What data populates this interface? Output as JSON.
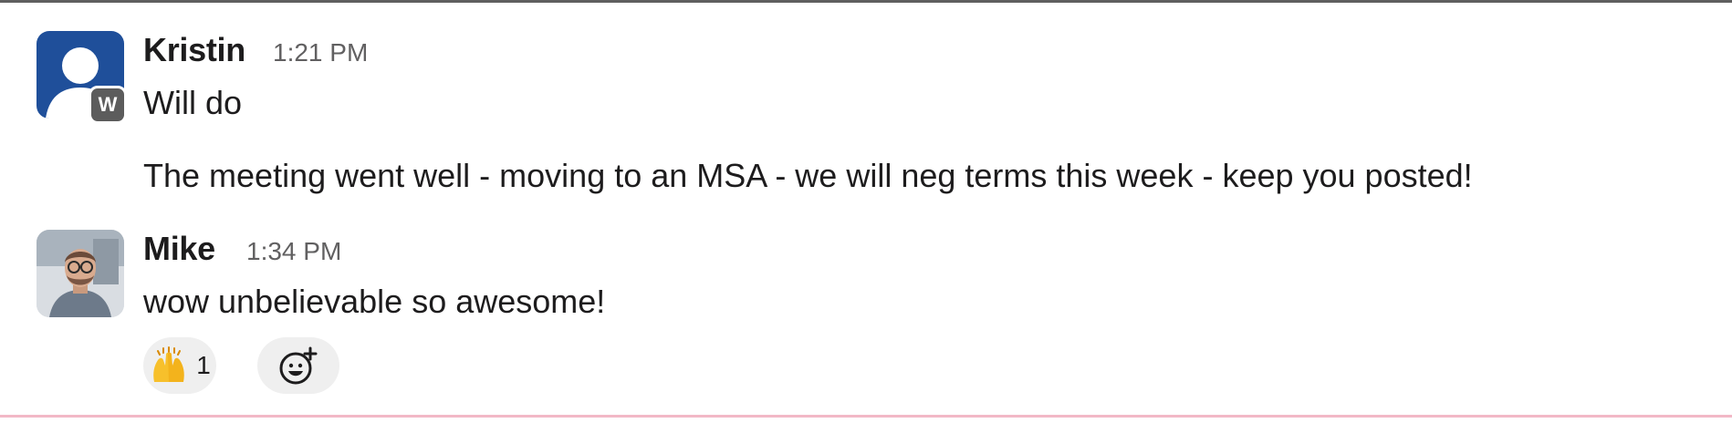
{
  "messages": [
    {
      "sender": "Kristin",
      "time": "1:21 PM",
      "workspace_badge": "W",
      "lines": [
        "Will do",
        "The meeting went well - moving to an MSA - we will neg terms this week - keep you posted!"
      ]
    },
    {
      "sender": "Mike",
      "time": "1:34 PM",
      "lines": [
        "wow unbelievable so awesome!"
      ],
      "reactions": [
        {
          "emoji": "raising-hands",
          "count": "1"
        }
      ]
    }
  ],
  "colors": {
    "kristin_avatar_bg": "#1f4f9a",
    "badge_bg": "#5c5c5c",
    "reaction_bg": "#efefef",
    "timestamp": "#616061",
    "divider_pink": "#f2b8c6"
  }
}
